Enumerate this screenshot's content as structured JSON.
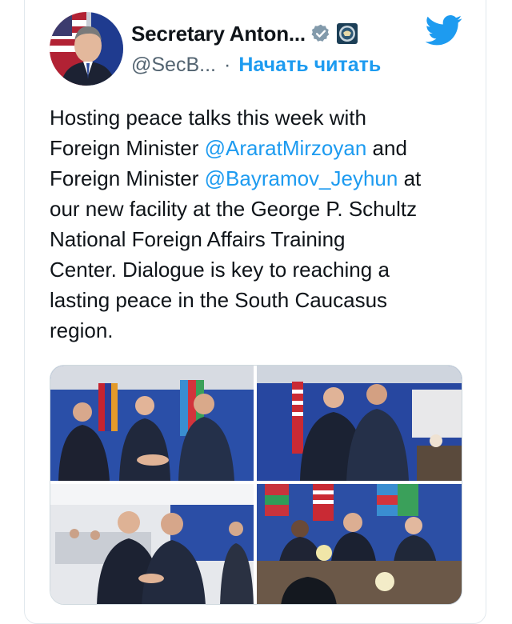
{
  "author": {
    "display_name": "Secretary Anton...",
    "handle": "@SecB...",
    "separator": "·",
    "follow_label": "Начать читать",
    "verified_icon": "verified-badge-icon",
    "affiliation_icon": "us-state-department-seal-icon"
  },
  "tweet": {
    "segments": [
      {
        "type": "text",
        "value": "Hosting peace talks this week with\nForeign Minister "
      },
      {
        "type": "mention",
        "value": "@AraratMirzoyan"
      },
      {
        "type": "text",
        "value": " and\nForeign Minister "
      },
      {
        "type": "mention",
        "value": "@Bayramov_Jeyhun"
      },
      {
        "type": "text",
        "value": " at\nour new facility at the George P. Schultz\nNational Foreign Affairs Training\nCenter. Dialogue is key to reaching a\nlasting peace in the South Caucasus\nregion."
      }
    ]
  },
  "media": {
    "photos": [
      {
        "name": "photo-handshake-three-ministers"
      },
      {
        "name": "photo-handshake-conversation"
      },
      {
        "name": "photo-handshake-office"
      },
      {
        "name": "photo-meeting-table"
      }
    ]
  },
  "colors": {
    "link": "#1d9bf0",
    "text": "#0f1419",
    "muted": "#536471",
    "verified": "#829aab",
    "twitter": "#1d9bf0"
  },
  "icons": {
    "brand": "twitter-bird-icon"
  }
}
